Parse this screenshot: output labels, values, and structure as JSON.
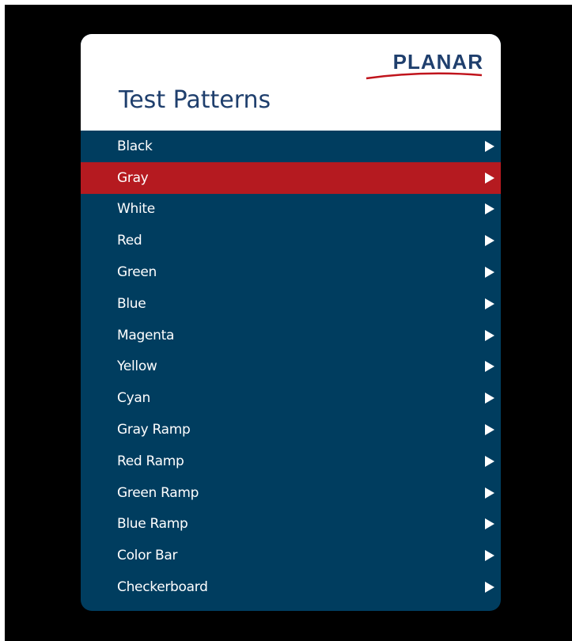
{
  "brand": {
    "logo_text": "PLANAR",
    "logo_color": "#1f3f6d",
    "swoosh_color": "#c0141c"
  },
  "panel": {
    "title": "Test Patterns"
  },
  "colors": {
    "panel_bg": "#003d5f",
    "selected_bg": "#b51a20",
    "screen_bg": "#000000"
  },
  "menu": {
    "selected_index": 1,
    "items": [
      {
        "label": "Black",
        "icon": "arrow-right-icon"
      },
      {
        "label": "Gray",
        "icon": "arrow-right-icon"
      },
      {
        "label": "White",
        "icon": "arrow-right-icon"
      },
      {
        "label": "Red",
        "icon": "arrow-right-icon"
      },
      {
        "label": "Green",
        "icon": "arrow-right-icon"
      },
      {
        "label": "Blue",
        "icon": "arrow-right-icon"
      },
      {
        "label": "Magenta",
        "icon": "arrow-right-icon"
      },
      {
        "label": "Yellow",
        "icon": "arrow-right-icon"
      },
      {
        "label": "Cyan",
        "icon": "arrow-right-icon"
      },
      {
        "label": "Gray Ramp",
        "icon": "arrow-right-icon"
      },
      {
        "label": "Red Ramp",
        "icon": "arrow-right-icon"
      },
      {
        "label": "Green Ramp",
        "icon": "arrow-right-icon"
      },
      {
        "label": "Blue Ramp",
        "icon": "arrow-right-icon"
      },
      {
        "label": "Color Bar",
        "icon": "arrow-right-icon"
      },
      {
        "label": "Checkerboard",
        "icon": "arrow-right-icon"
      }
    ]
  }
}
